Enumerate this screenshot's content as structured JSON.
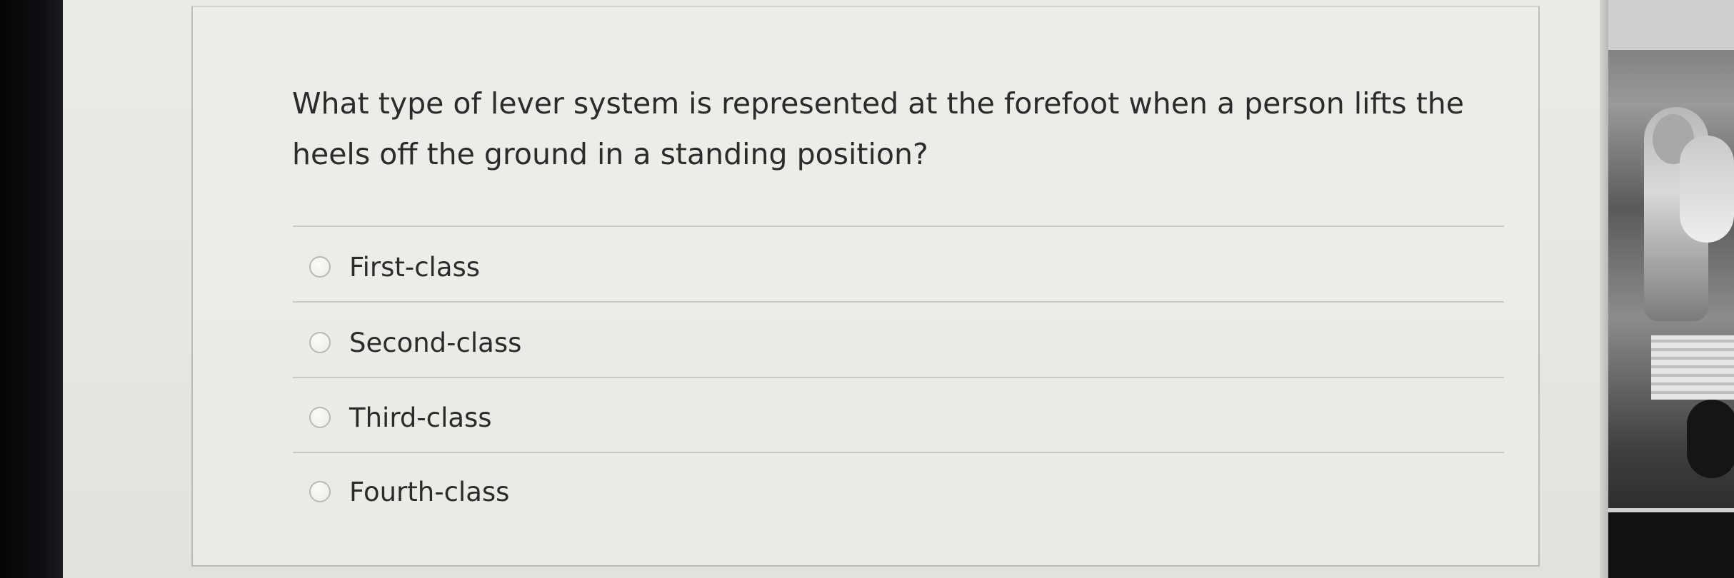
{
  "quiz": {
    "question": "What type of lever system is represented at the forefoot when a person lifts the heels off the ground in a standing position?",
    "options": [
      {
        "label": "First-class",
        "selected": false
      },
      {
        "label": "Second-class",
        "selected": false
      },
      {
        "label": "Third-class",
        "selected": false
      },
      {
        "label": "Fourth-class",
        "selected": false
      }
    ]
  },
  "colors": {
    "page_background": "#e9e8e4",
    "text": "#2b2b2b",
    "divider": "#c9c8c4",
    "radio_border": "#b9b8b4"
  }
}
